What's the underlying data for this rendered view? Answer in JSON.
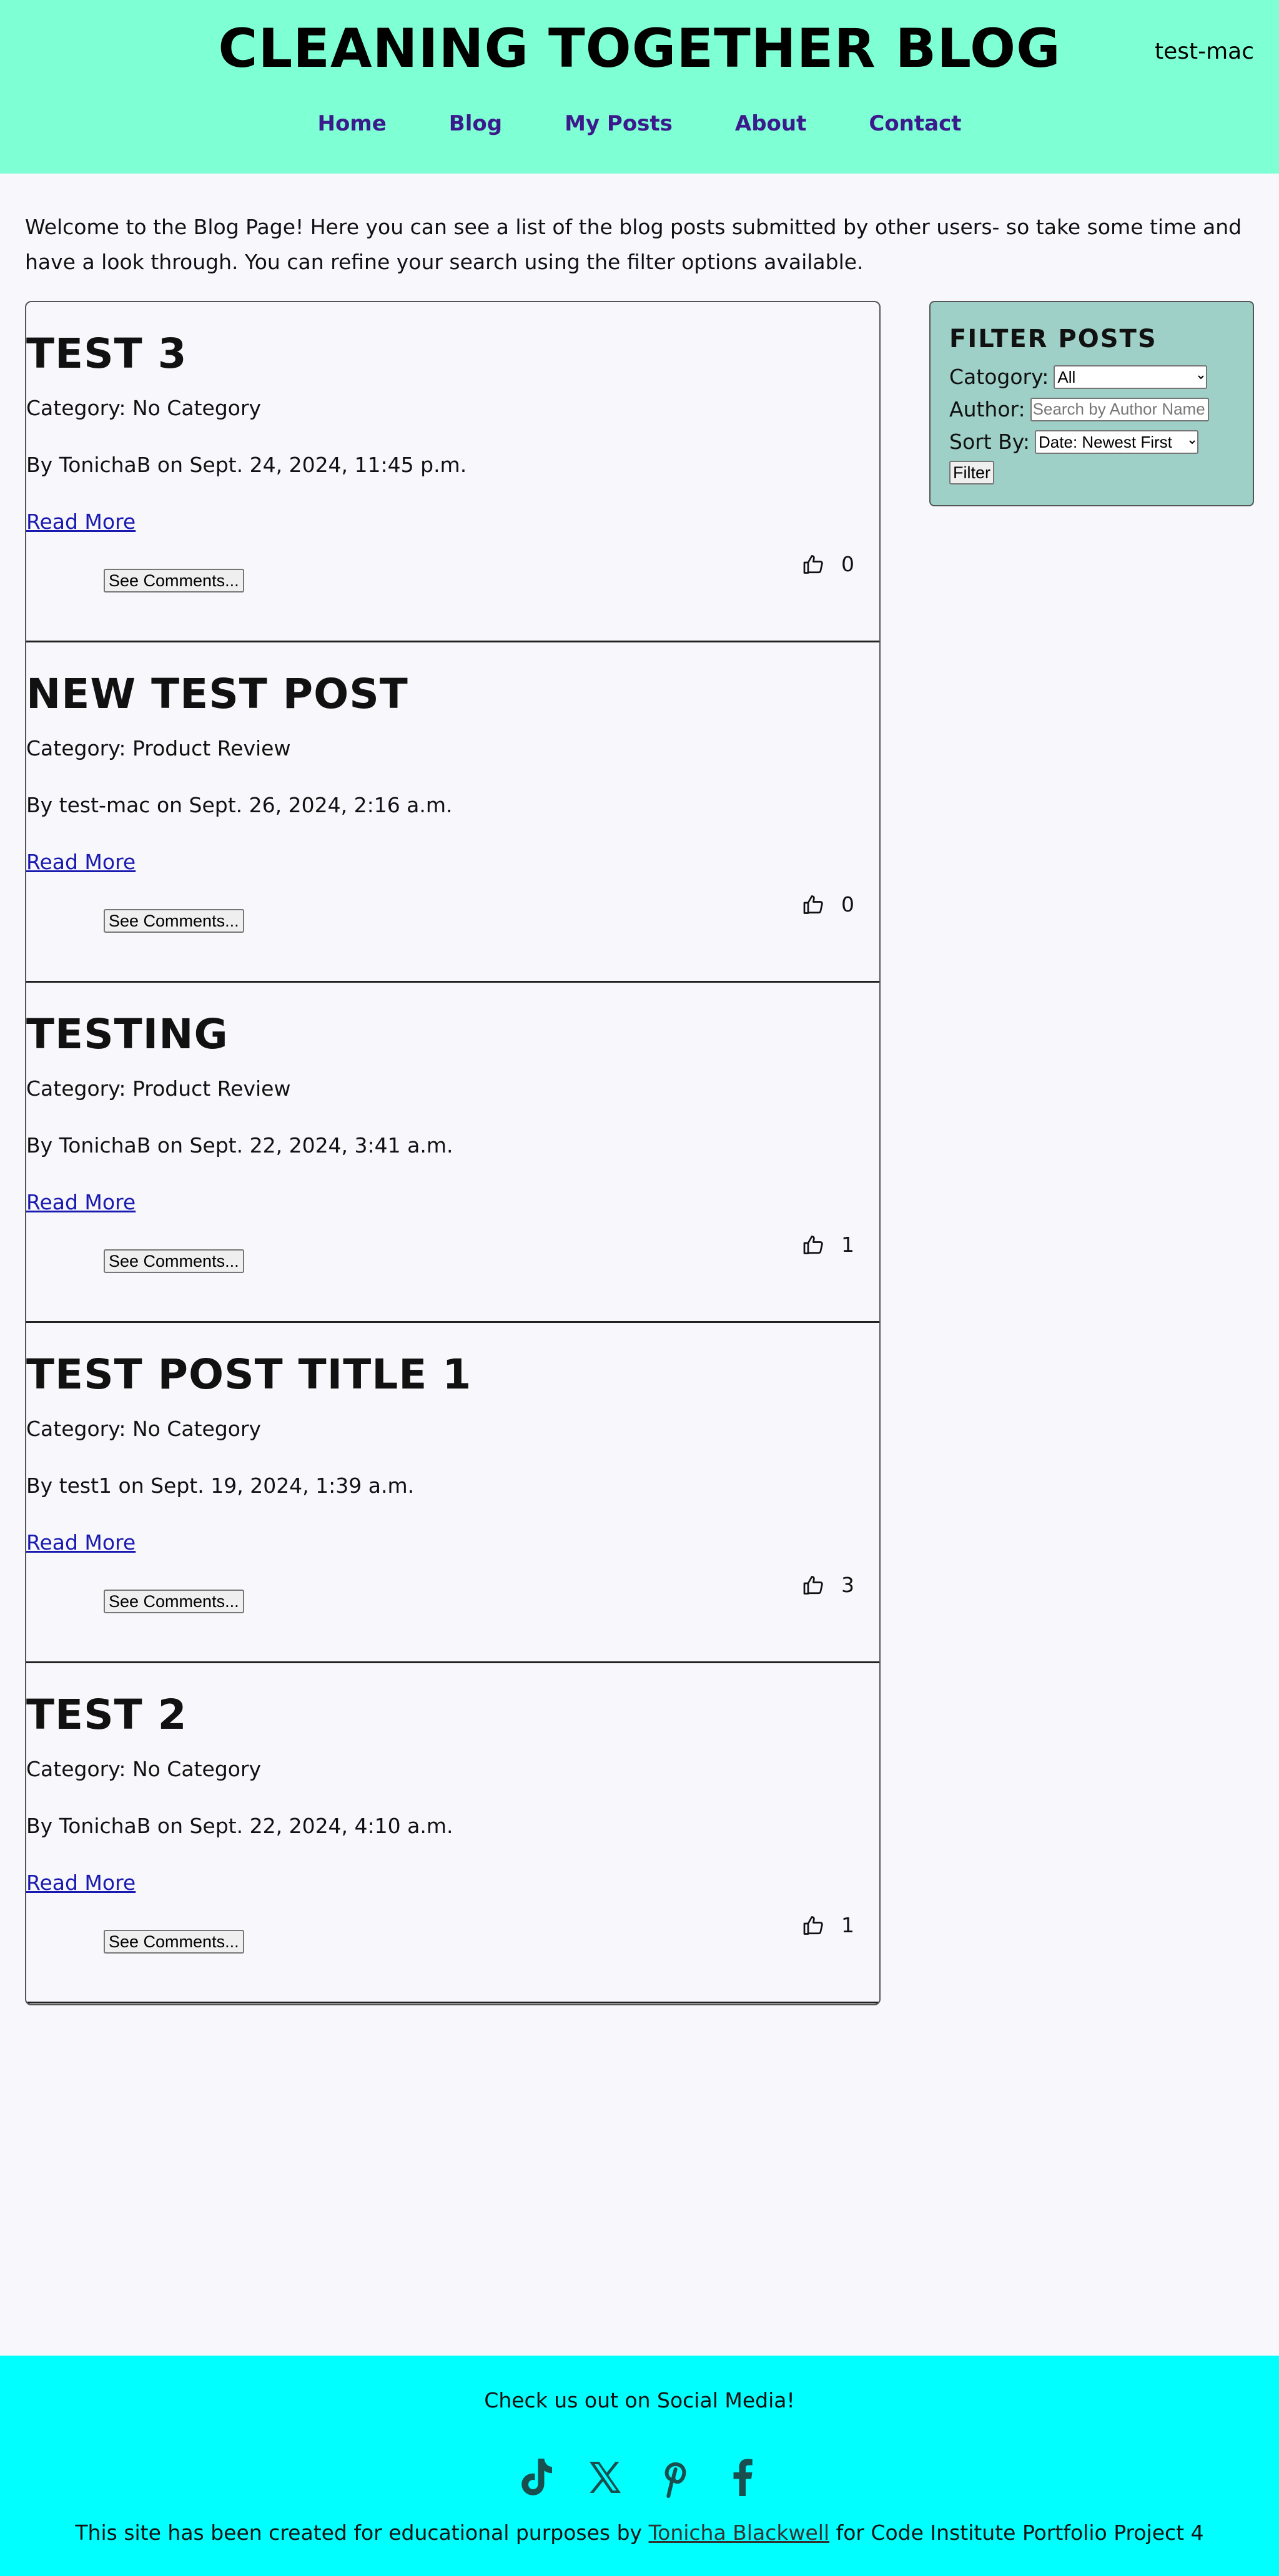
{
  "header": {
    "site_title": "CLEANING TOGETHER BLOG",
    "username": "test-mac",
    "nav": [
      {
        "label": "Home"
      },
      {
        "label": "Blog"
      },
      {
        "label": "My Posts"
      },
      {
        "label": "About"
      },
      {
        "label": "Contact"
      }
    ]
  },
  "intro": "Welcome to the Blog Page! Here you can see a list of the blog posts submitted by other users- so take some time and have a look through. You can refine your search using the filter options available.",
  "posts": [
    {
      "title": "TEST 3",
      "category": "Category: No Category",
      "byline": "By TonichaB on Sept. 24, 2024, 11:45 p.m.",
      "read_more": "Read More",
      "comments_button": "See Comments...",
      "likes": "0"
    },
    {
      "title": "NEW TEST POST",
      "category": "Category: Product Review",
      "byline": "By test-mac on Sept. 26, 2024, 2:16 a.m.",
      "read_more": "Read More",
      "comments_button": "See Comments...",
      "likes": "0"
    },
    {
      "title": "TESTING",
      "category": "Category: Product Review",
      "byline": "By TonichaB on Sept. 22, 2024, 3:41 a.m.",
      "read_more": "Read More",
      "comments_button": "See Comments...",
      "likes": "1"
    },
    {
      "title": "TEST POST TITLE 1",
      "category": "Category: No Category",
      "byline": "By test1 on Sept. 19, 2024, 1:39 a.m.",
      "read_more": "Read More",
      "comments_button": "See Comments...",
      "likes": "3"
    },
    {
      "title": "TEST 2",
      "category": "Category: No Category",
      "byline": "By TonichaB on Sept. 22, 2024, 4:10 a.m.",
      "read_more": "Read More",
      "comments_button": "See Comments...",
      "likes": "1"
    }
  ],
  "filter": {
    "title": "FILTER POSTS",
    "category_label": "Catogory:",
    "category_value": "All",
    "author_label": "Author:",
    "author_placeholder": "Search by Author Name",
    "sort_label": "Sort By:",
    "sort_value": "Date: Newest First",
    "button": "Filter"
  },
  "footer": {
    "heading": "Check us out on Social Media!",
    "social_icons": [
      "tiktok-icon",
      "x-icon",
      "pinterest-icon",
      "facebook-icon"
    ],
    "credit_before": "This site has been created for educational purposes by ",
    "credit_link": "Tonicha Blackwell",
    "credit_after": " for Code Institute Portfolio Project 4"
  },
  "colors": {
    "header_bg": "#7fffd4",
    "nav_link": "#3b1a8c",
    "filter_bg": "#9ed0c8",
    "footer_bg": "#00ffff",
    "link": "#1a1ab0"
  }
}
